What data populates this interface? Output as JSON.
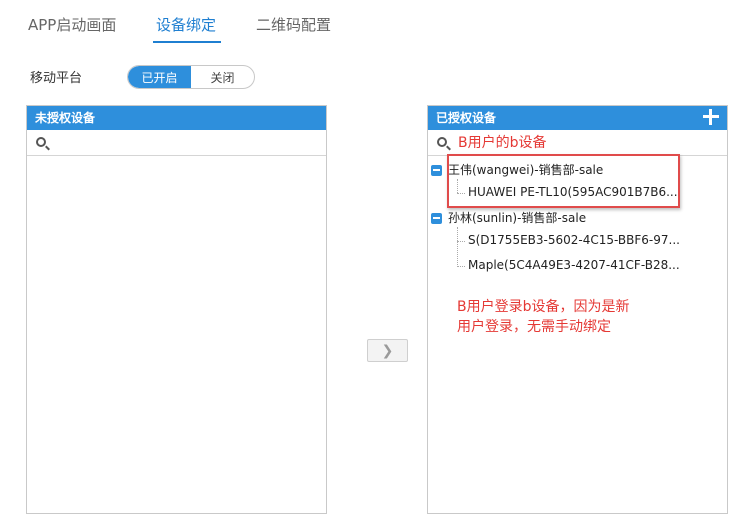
{
  "tabs": [
    {
      "label": "APP启动画面",
      "active": false
    },
    {
      "label": "设备绑定",
      "active": true
    },
    {
      "label": "二维码配置",
      "active": false
    }
  ],
  "platform": {
    "label": "移动平台",
    "on_label": "已开启",
    "off_label": "关闭",
    "enabled": true
  },
  "left_panel": {
    "title": "未授权设备",
    "search_value": ""
  },
  "right_panel": {
    "title": "已授权设备",
    "search_value": "",
    "groups": [
      {
        "label": "王伟(wangwei)-销售部-sale",
        "devices": [
          "HUAWEI PE-TL10(595AC901B7B6..."
        ]
      },
      {
        "label": "孙林(sunlin)-销售部-sale",
        "devices": [
          "S(D1755EB3-5602-4C15-BBF6-97...",
          "Maple(5C4A49E3-4207-41CF-B28..."
        ]
      }
    ]
  },
  "annotations": {
    "title": "B用户的b设备",
    "note_line1": "B用户登录b设备，因为是新",
    "note_line2": "用户登录，无需手动绑定"
  },
  "transfer_button": {
    "label": "❯",
    "enabled": false
  },
  "colors": {
    "accent": "#2e8fdc",
    "annotation": "#e53935"
  }
}
